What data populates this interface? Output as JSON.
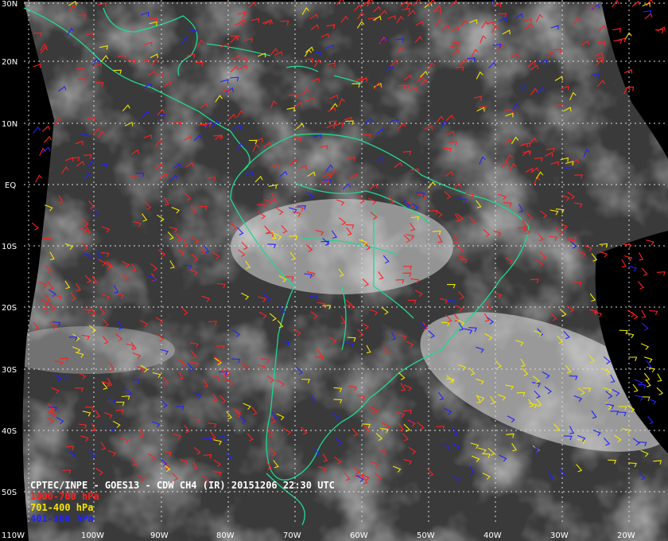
{
  "title": "CPTEC/INPE - GOES13 - CDW CH4 (IR) 20151206 22:30 UTC",
  "legend": [
    {
      "label": "1000-700 hPa",
      "color": "#ff2020"
    },
    {
      "label": "701-400 hPa",
      "color": "#f2e600"
    },
    {
      "label": "401-100 hPa",
      "color": "#2222ff"
    }
  ],
  "lat_labels": [
    "30N",
    "20N",
    "10N",
    "EQ",
    "10S",
    "20S",
    "30S",
    "40S",
    "50S"
  ],
  "lon_labels": [
    "110W",
    "100W",
    "90W",
    "80W",
    "70W",
    "60W",
    "50W",
    "40W",
    "30W",
    "20W"
  ],
  "colors": {
    "background": "#000000",
    "coastline": "#20d890",
    "grid": "#dddddd"
  }
}
